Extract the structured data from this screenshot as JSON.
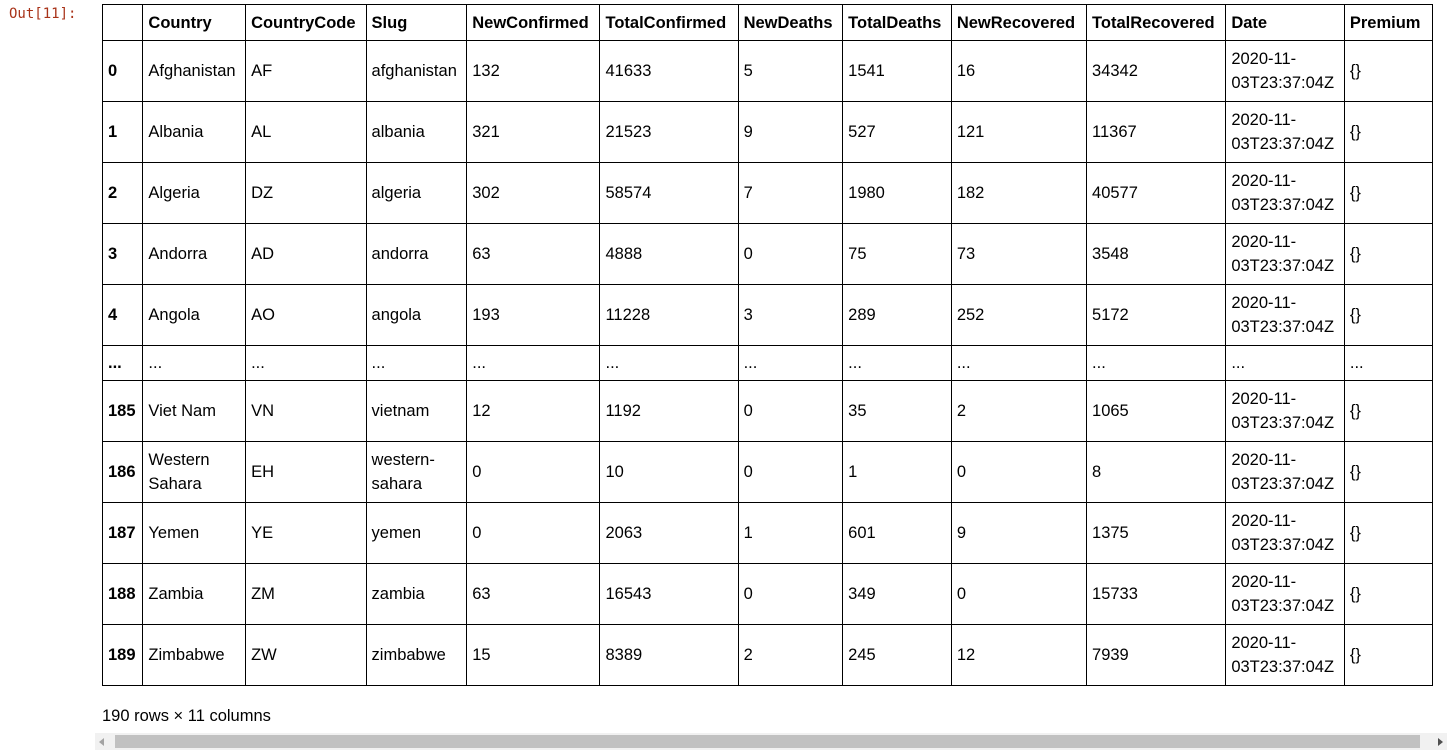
{
  "prompt": "Out[11]:",
  "columns": [
    "",
    "Country",
    "CountryCode",
    "Slug",
    "NewConfirmed",
    "TotalConfirmed",
    "NewDeaths",
    "TotalDeaths",
    "NewRecovered",
    "TotalRecovered",
    "Date",
    "Premium"
  ],
  "rows": [
    {
      "index": "0",
      "Country": "Afghanistan",
      "CountryCode": "AF",
      "Slug": "afghanistan",
      "NewConfirmed": "132",
      "TotalConfirmed": "41633",
      "NewDeaths": "5",
      "TotalDeaths": "1541",
      "NewRecovered": "16",
      "TotalRecovered": "34342",
      "Date": "2020-11-03T23:37:04Z",
      "Premium": "{}"
    },
    {
      "index": "1",
      "Country": "Albania",
      "CountryCode": "AL",
      "Slug": "albania",
      "NewConfirmed": "321",
      "TotalConfirmed": "21523",
      "NewDeaths": "9",
      "TotalDeaths": "527",
      "NewRecovered": "121",
      "TotalRecovered": "11367",
      "Date": "2020-11-03T23:37:04Z",
      "Premium": "{}"
    },
    {
      "index": "2",
      "Country": "Algeria",
      "CountryCode": "DZ",
      "Slug": "algeria",
      "NewConfirmed": "302",
      "TotalConfirmed": "58574",
      "NewDeaths": "7",
      "TotalDeaths": "1980",
      "NewRecovered": "182",
      "TotalRecovered": "40577",
      "Date": "2020-11-03T23:37:04Z",
      "Premium": "{}"
    },
    {
      "index": "3",
      "Country": "Andorra",
      "CountryCode": "AD",
      "Slug": "andorra",
      "NewConfirmed": "63",
      "TotalConfirmed": "4888",
      "NewDeaths": "0",
      "TotalDeaths": "75",
      "NewRecovered": "73",
      "TotalRecovered": "3548",
      "Date": "2020-11-03T23:37:04Z",
      "Premium": "{}"
    },
    {
      "index": "4",
      "Country": "Angola",
      "CountryCode": "AO",
      "Slug": "angola",
      "NewConfirmed": "193",
      "TotalConfirmed": "11228",
      "NewDeaths": "3",
      "TotalDeaths": "289",
      "NewRecovered": "252",
      "TotalRecovered": "5172",
      "Date": "2020-11-03T23:37:04Z",
      "Premium": "{}"
    },
    {
      "index": "...",
      "Country": "...",
      "CountryCode": "...",
      "Slug": "...",
      "NewConfirmed": "...",
      "TotalConfirmed": "...",
      "NewDeaths": "...",
      "TotalDeaths": "...",
      "NewRecovered": "...",
      "TotalRecovered": "...",
      "Date": "...",
      "Premium": "..."
    },
    {
      "index": "185",
      "Country": "Viet Nam",
      "CountryCode": "VN",
      "Slug": "vietnam",
      "NewConfirmed": "12",
      "TotalConfirmed": "1192",
      "NewDeaths": "0",
      "TotalDeaths": "35",
      "NewRecovered": "2",
      "TotalRecovered": "1065",
      "Date": "2020-11-03T23:37:04Z",
      "Premium": "{}"
    },
    {
      "index": "186",
      "Country": "Western Sahara",
      "CountryCode": "EH",
      "Slug": "western-sahara",
      "NewConfirmed": "0",
      "TotalConfirmed": "10",
      "NewDeaths": "0",
      "TotalDeaths": "1",
      "NewRecovered": "0",
      "TotalRecovered": "8",
      "Date": "2020-11-03T23:37:04Z",
      "Premium": "{}"
    },
    {
      "index": "187",
      "Country": "Yemen",
      "CountryCode": "YE",
      "Slug": "yemen",
      "NewConfirmed": "0",
      "TotalConfirmed": "2063",
      "NewDeaths": "1",
      "TotalDeaths": "601",
      "NewRecovered": "9",
      "TotalRecovered": "1375",
      "Date": "2020-11-03T23:37:04Z",
      "Premium": "{}"
    },
    {
      "index": "188",
      "Country": "Zambia",
      "CountryCode": "ZM",
      "Slug": "zambia",
      "NewConfirmed": "63",
      "TotalConfirmed": "16543",
      "NewDeaths": "0",
      "TotalDeaths": "349",
      "NewRecovered": "0",
      "TotalRecovered": "15733",
      "Date": "2020-11-03T23:37:04Z",
      "Premium": "{}"
    },
    {
      "index": "189",
      "Country": "Zimbabwe",
      "CountryCode": "ZW",
      "Slug": "zimbabwe",
      "NewConfirmed": "15",
      "TotalConfirmed": "8389",
      "NewDeaths": "2",
      "TotalDeaths": "245",
      "NewRecovered": "12",
      "TotalRecovered": "7939",
      "Date": "2020-11-03T23:37:04Z",
      "Premium": "{}"
    }
  ],
  "footer": "190 rows × 11 columns"
}
